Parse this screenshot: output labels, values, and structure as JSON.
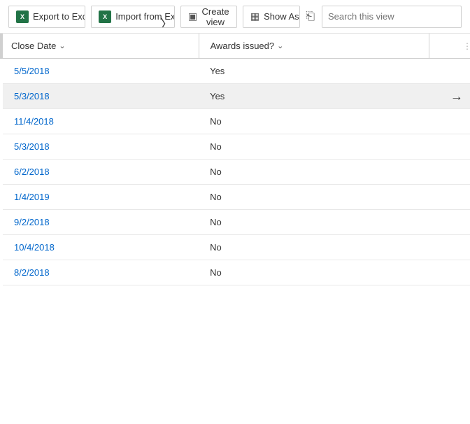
{
  "toolbar": {
    "export_label": "Export to Excel",
    "import_label": "Import from Excel",
    "create_view_label": "Create view",
    "show_as_label": "Show As"
  },
  "search": {
    "placeholder": "Search this view"
  },
  "table": {
    "columns": [
      {
        "key": "close_date",
        "label": "Close Date"
      },
      {
        "key": "awards_issued",
        "label": "Awards issued?"
      }
    ],
    "rows": [
      {
        "close_date": "5/5/2018",
        "awards_issued": "Yes",
        "highlighted": false
      },
      {
        "close_date": "5/3/2018",
        "awards_issued": "Yes",
        "highlighted": true
      },
      {
        "close_date": "11/4/2018",
        "awards_issued": "No",
        "highlighted": false
      },
      {
        "close_date": "5/3/2018",
        "awards_issued": "No",
        "highlighted": false
      },
      {
        "close_date": "6/2/2018",
        "awards_issued": "No",
        "highlighted": false
      },
      {
        "close_date": "1/4/2019",
        "awards_issued": "No",
        "highlighted": false
      },
      {
        "close_date": "9/2/2018",
        "awards_issued": "No",
        "highlighted": false
      },
      {
        "close_date": "10/4/2018",
        "awards_issued": "No",
        "highlighted": false
      },
      {
        "close_date": "8/2/2018",
        "awards_issued": "No",
        "highlighted": false
      }
    ]
  }
}
